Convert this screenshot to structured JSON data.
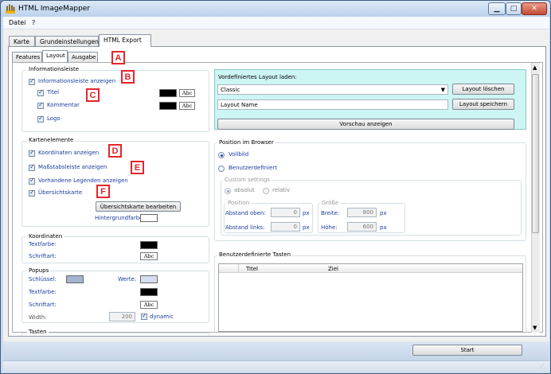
{
  "window": {
    "title": "HTML ImageMapper"
  },
  "menu": [
    "Datei",
    "?"
  ],
  "tabs": [
    "Karte",
    "Grundeinstellungen",
    "HTML Export"
  ],
  "subtabs": [
    "Features",
    "Layout",
    "Ausgabe"
  ],
  "markers": [
    "A",
    "B",
    "C",
    "D",
    "E",
    "F"
  ],
  "info": {
    "group_title": "Informationsleiste",
    "show_label": "Informationsleiste anzeigen",
    "items": [
      "Titel",
      "Kommentar",
      "Logo"
    ],
    "abc": "Abc"
  },
  "kartenelemente": {
    "group_title": "Kartenelemente",
    "items": [
      "Koordinaten anzeigen",
      "Maßstabsleiste anzeigen",
      "Vorhandene Legenden anzeigen",
      "Übersichtskarte"
    ],
    "edit_button": "Übersichtskarte bearbeiten",
    "bg_label": "Hintergrundfarbe:"
  },
  "koordinaten": {
    "group_title": "Koordinaten",
    "textfarbe": "Textfarbe:",
    "schriftart": "Schriftart:",
    "abc": "Abc"
  },
  "popups": {
    "group_title": "Popups",
    "schluessel": "Schlüssel:",
    "werte": "Werte:",
    "textfarbe": "Textfarbe:",
    "schriftart": "Schriftart:",
    "abc": "Abc",
    "width_label": "Width:",
    "width_value": "200",
    "dynamic": "dynamic"
  },
  "tasten": {
    "group_title": "Tasten"
  },
  "preset": {
    "label": "Vordefiniertes Layout laden:",
    "selected": "Classic",
    "delete_button": "Layout löschen",
    "name_value": "Layout Name",
    "save_button": "Layout speichern",
    "preview_button": "Vorschau anzeigen"
  },
  "position": {
    "group_title": "Position im Browser",
    "vollbild": "Vollbild",
    "benutzer": "Benutzerdefiniert",
    "custom_title": "Custom settings",
    "absolut": "absolut",
    "relativ": "relativ",
    "pos_title": "Position",
    "abstand_oben": "Abstand oben:",
    "abstand_oben_value": "0",
    "abstand_links": "Abstand links:",
    "abstand_links_value": "0",
    "px": "px",
    "size_title": "Größe",
    "breite": "Breite:",
    "breite_value": "800",
    "hoehe": "Höhe:",
    "hoehe_value": "600"
  },
  "tasten_table": {
    "group_title": "Benutzerdefinierte Tasten",
    "columns": [
      "Titel",
      "Ziel"
    ]
  },
  "start_button": "Start",
  "colors": {
    "accent": "#e4252b",
    "preset_bg": "#cdf5f3",
    "link_blue": "#1a3d9e",
    "frame": "#c9dbee"
  }
}
